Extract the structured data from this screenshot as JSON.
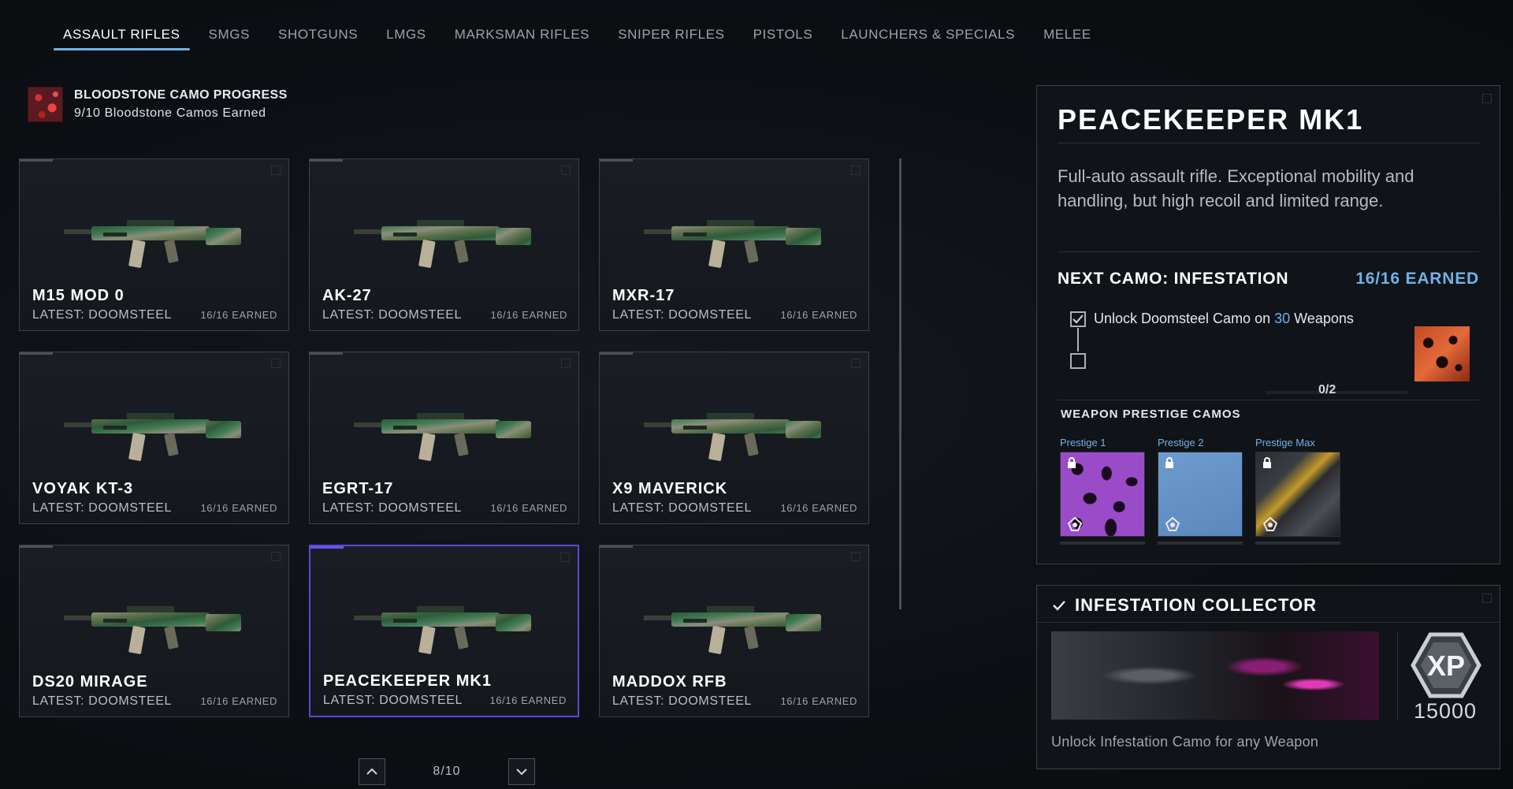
{
  "tabs": [
    {
      "label": "ASSAULT RIFLES",
      "active": true
    },
    {
      "label": "SMGS",
      "active": false
    },
    {
      "label": "SHOTGUNS",
      "active": false
    },
    {
      "label": "LMGS",
      "active": false
    },
    {
      "label": "MARKSMAN RIFLES",
      "active": false
    },
    {
      "label": "SNIPER RIFLES",
      "active": false
    },
    {
      "label": "PISTOLS",
      "active": false
    },
    {
      "label": "LAUNCHERS & SPECIALS",
      "active": false
    },
    {
      "label": "MELEE",
      "active": false
    }
  ],
  "camo_progress": {
    "title": "BLOODSTONE CAMO PROGRESS",
    "subtitle": "9/10 Bloodstone Camos Earned"
  },
  "weapons": [
    {
      "name": "M15 MOD 0",
      "latest": "LATEST: DOOMSTEEL",
      "earned": "16/16 EARNED"
    },
    {
      "name": "AK-27",
      "latest": "LATEST: DOOMSTEEL",
      "earned": "16/16 EARNED"
    },
    {
      "name": "MXR-17",
      "latest": "LATEST: DOOMSTEEL",
      "earned": "16/16 EARNED"
    },
    {
      "name": "VOYAK KT-3",
      "latest": "LATEST: DOOMSTEEL",
      "earned": "16/16 EARNED"
    },
    {
      "name": "EGRT-17",
      "latest": "LATEST: DOOMSTEEL",
      "earned": "16/16 EARNED"
    },
    {
      "name": "X9 MAVERICK",
      "latest": "LATEST: DOOMSTEEL",
      "earned": "16/16 EARNED"
    },
    {
      "name": "DS20 MIRAGE",
      "latest": "LATEST: DOOMSTEEL",
      "earned": "16/16 EARNED"
    },
    {
      "name": "PEACEKEEPER MK1",
      "latest": "LATEST: DOOMSTEEL",
      "earned": "16/16 EARNED"
    },
    {
      "name": "MADDOX RFB",
      "latest": "LATEST: DOOMSTEEL",
      "earned": "16/16 EARNED"
    }
  ],
  "selected_weapon_index": 7,
  "pager": {
    "page": "8/10"
  },
  "detail": {
    "title": "PEACEKEEPER MK1",
    "description": "Full-auto assault rifle. Exceptional mobility and handling, but high recoil and limited range.",
    "next_camo": "NEXT CAMO: INFESTATION",
    "next_earned": "16/16 EARNED",
    "challenge_prefix": "Unlock Doomsteel Camo on ",
    "challenge_count": "30",
    "challenge_suffix": " Weapons",
    "challenge_progress": "0/2",
    "prestige_title": "WEAPON PRESTIGE CAMOS",
    "prestige": [
      {
        "label": "Prestige 1"
      },
      {
        "label": "Prestige 2"
      },
      {
        "label": "Prestige Max"
      }
    ]
  },
  "collector": {
    "title": "INFESTATION COLLECTOR",
    "xp_label": "XP",
    "xp_value": "15000",
    "description": "Unlock Infestation Camo for any Weapon"
  },
  "colors": {
    "accent_blue": "#6fb2e8",
    "selected_border": "#5a48d8"
  }
}
